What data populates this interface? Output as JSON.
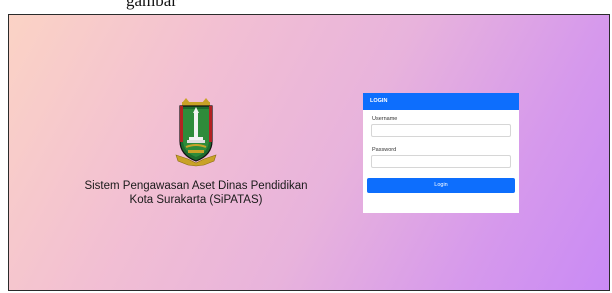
{
  "caption": {
    "text": "gambar"
  },
  "brand": {
    "logo_icon": "surakarta-crest-icon",
    "title_line1": "Sistem Pengawasan Aset Dinas Pendidikan",
    "title_line2": "Kota Surakarta (SiPATAS)"
  },
  "login": {
    "header": "LOGIN",
    "username_label": "Username",
    "username_value": "",
    "password_label": "Password",
    "password_value": "",
    "button_label": "Login"
  },
  "colors": {
    "accent": "#0d6efd",
    "gradient_start": "#fbd3c5",
    "gradient_end": "#c98af5"
  }
}
